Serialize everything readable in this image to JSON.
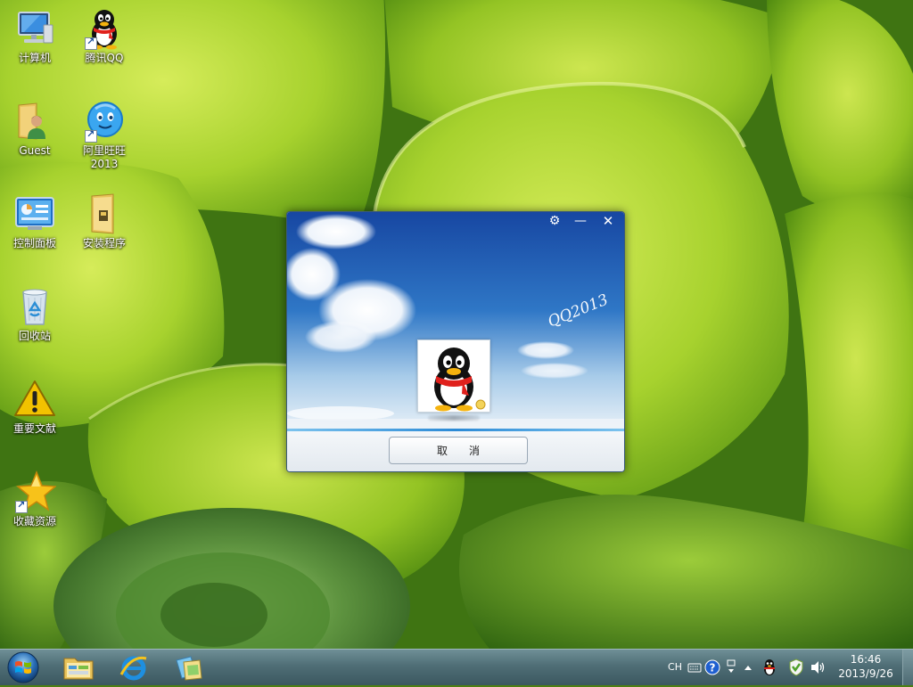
{
  "desktop": {
    "icons": [
      {
        "label": "计算机",
        "icon": "computer-icon"
      },
      {
        "label": "腾讯QQ",
        "icon": "qq-penguin-icon"
      },
      {
        "label": "Guest",
        "icon": "user-folder-icon"
      },
      {
        "label": "阿里旺旺\n2013",
        "icon": "aliwangwang-icon"
      },
      {
        "label": "控制面板",
        "icon": "control-panel-icon"
      },
      {
        "label": "安装程序",
        "icon": "folder-icon"
      },
      {
        "label": "回收站",
        "icon": "recycle-bin-icon"
      },
      {
        "label": "重要文献",
        "icon": "warning-icon"
      },
      {
        "label": "收藏资源",
        "icon": "star-icon"
      }
    ]
  },
  "qq_login": {
    "cancel_label": "取　　消",
    "signature": "QQ2013",
    "window_controls": [
      "gear-icon",
      "minimize-icon",
      "close-icon"
    ]
  },
  "taskbar": {
    "pinned": [
      "windows-explorer-icon",
      "internet-explorer-icon",
      "libraries-icon"
    ],
    "tray": {
      "language": "CH",
      "time": "16:46",
      "date": "2013/9/26"
    }
  },
  "colors": {
    "taskbar": "#4f6e76",
    "sky_top": "#1a4fa8",
    "wallpaper_green": "#8cc21f"
  }
}
